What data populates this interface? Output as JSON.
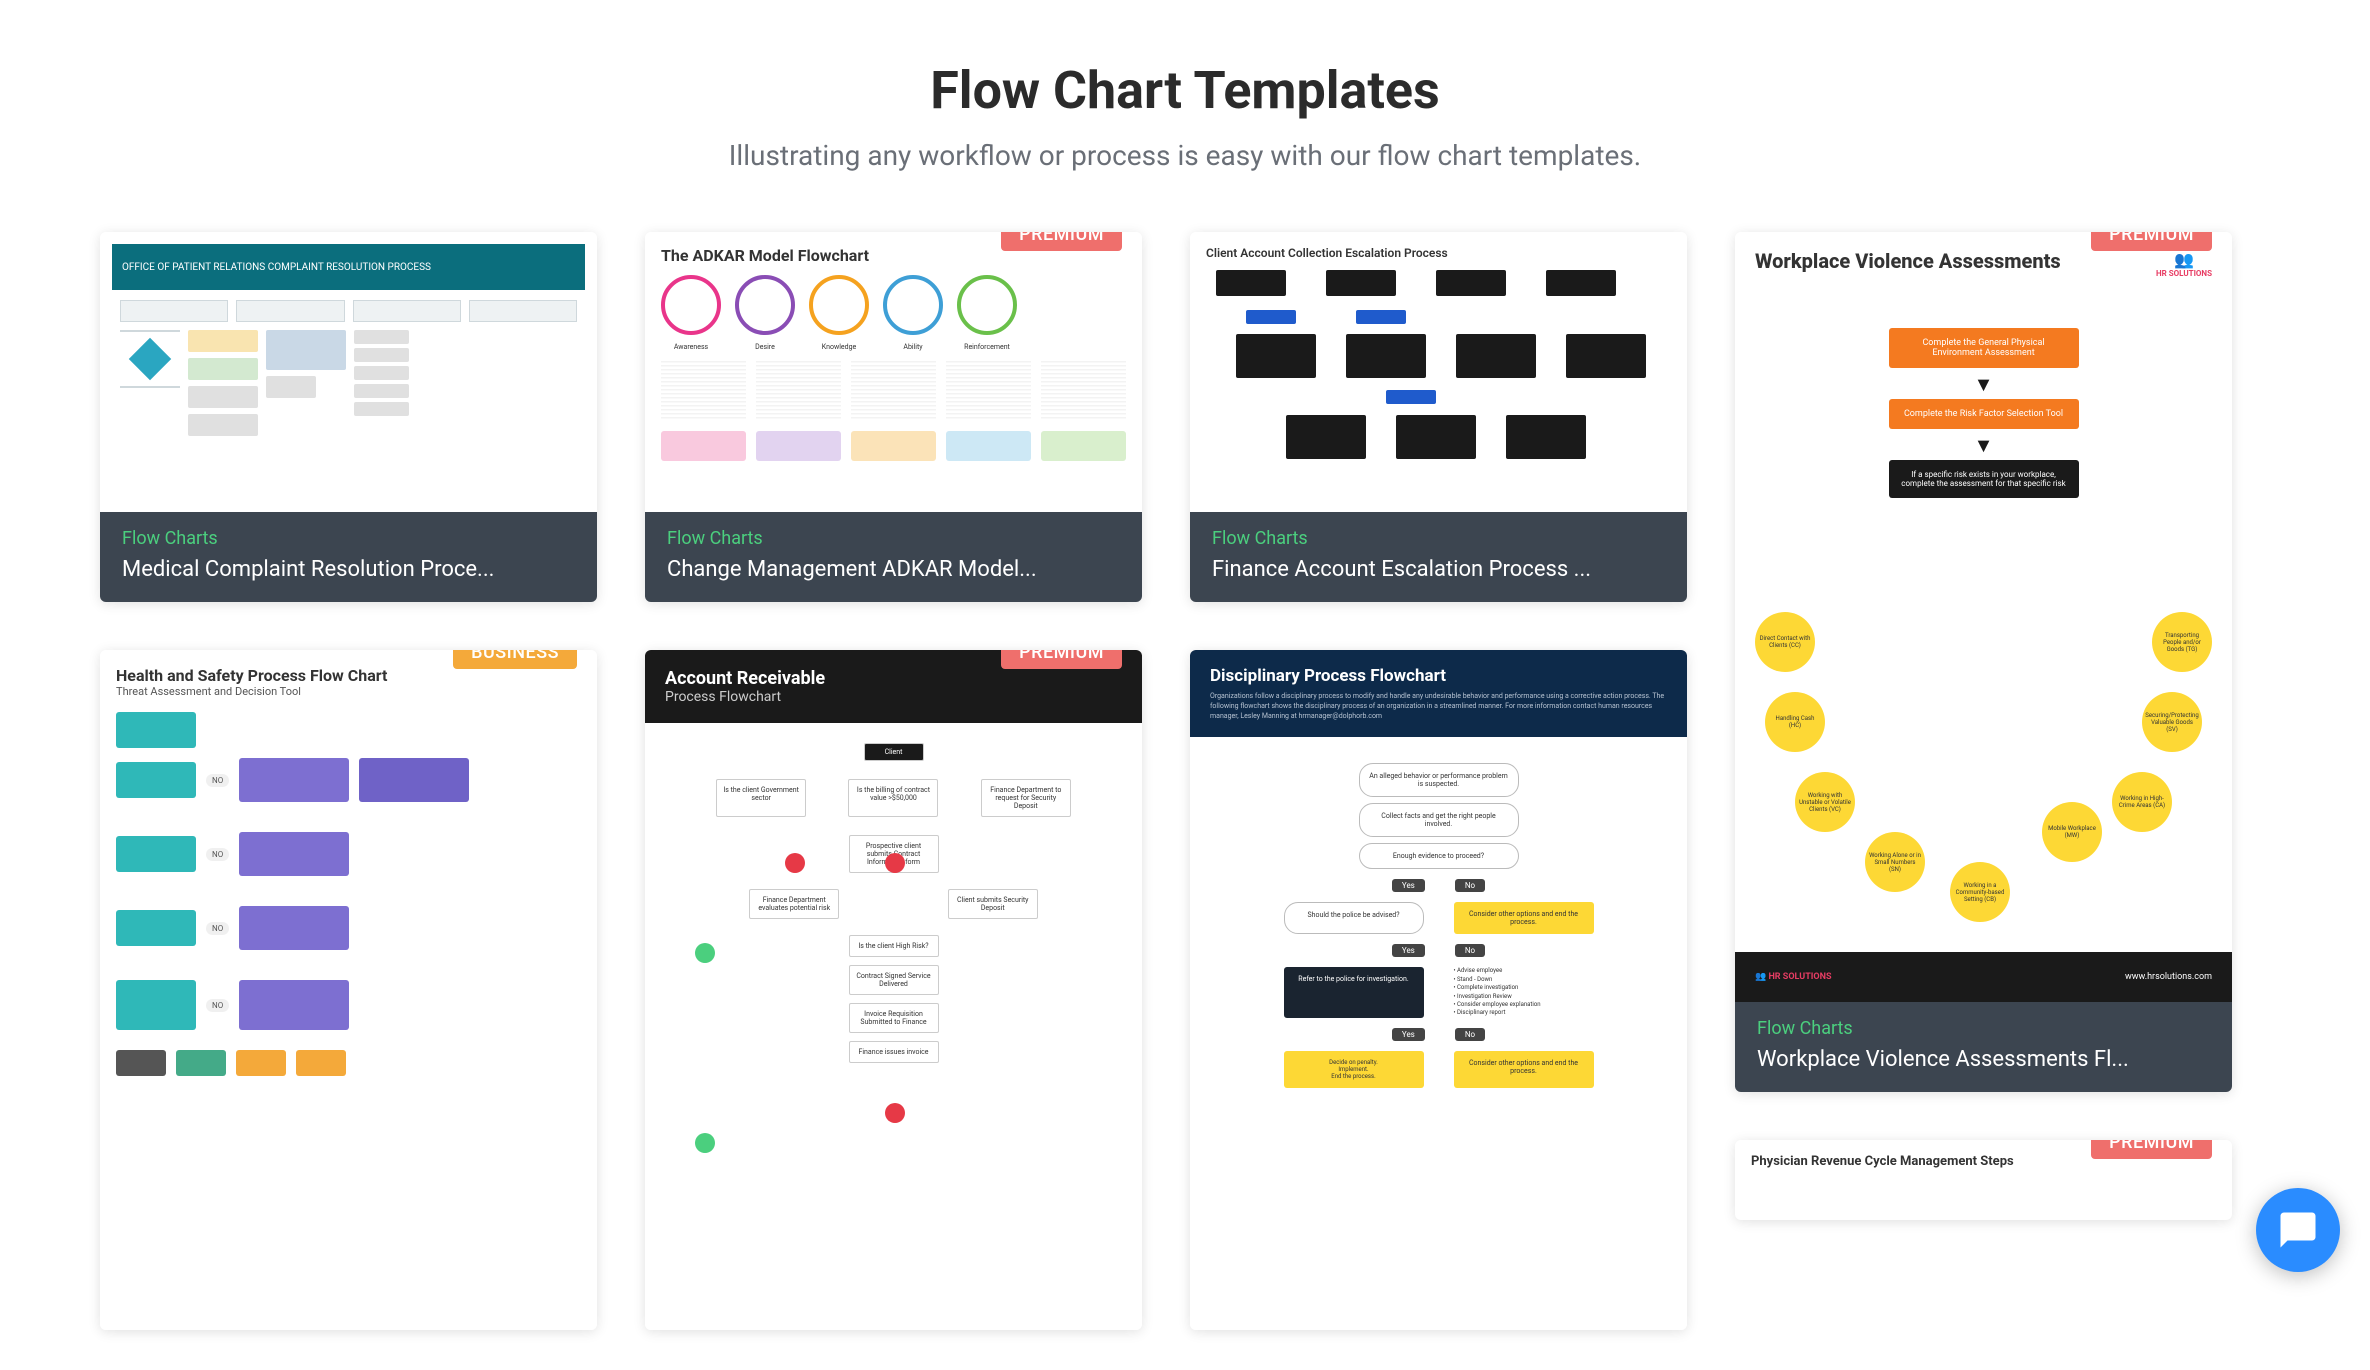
{
  "header": {
    "title": "Flow Chart Templates",
    "subtitle": "Illustrating any workflow or process is easy with our flow chart templates."
  },
  "badges": {
    "premium": "PREMIUM",
    "business": "BUSINESS"
  },
  "category": "Flow Charts",
  "cards": {
    "medical": {
      "title": "Medical Complaint Resolution Proce...",
      "thumb_header": "OFFICE OF PATIENT RELATIONS COMPLAINT RESOLUTION PROCESS"
    },
    "adkar": {
      "title": "Change Management ADKAR Model...",
      "thumb_title": "The ADKAR Model Flowchart",
      "labels": [
        "Awareness",
        "Desire",
        "Knowledge",
        "Ability",
        "Reinforcement"
      ]
    },
    "finance": {
      "title": "Finance Account Escalation Process ...",
      "thumb_title": "Client Account Collection Escalation Process"
    },
    "violence": {
      "title": "Workplace Violence Assessments Fl...",
      "thumb_title": "Workplace Violence Assessments",
      "brand": "HR SOLUTIONS",
      "url": "www.hrsolutions.com",
      "box1": "Complete the General Physical Environment Assessment",
      "box2": "Complete the Risk Factor Selection Tool",
      "box3": "If a specific risk exists in your workplace, complete the assessment for that specific risk",
      "y1": "Direct Contact with Clients (CC)",
      "y2": "Handling Cash (HC)",
      "y3": "Working with Unstable or Volatile Clients (VC)",
      "y4": "Working Alone or in Small Numbers (SN)",
      "y5": "Transporting People and/or Goods (TG)",
      "y6": "Securing/Protecting Valuable Goods (SV)",
      "y7": "Working in High-Crime Areas (CA)",
      "y8": "Mobile Workplace (MW)",
      "y9": "Working in a Community-based Setting (CB)"
    },
    "health": {
      "title_line1": "Health and Safety Process Flow Chart",
      "title_line2": "Threat Assessment and Decision Tool"
    },
    "ar": {
      "title_a": "Account Receivable",
      "title_b": "Process Flowchart",
      "client": "Client"
    },
    "disc": {
      "title": "Disciplinary Process Flowchart",
      "sub": "Organizations follow a disciplinary process to modify and handle any undesirable behavior and performance using a corrective action process. The following flowchart shows the disciplinary process of an organization in a streamlined manner. For more information contact human resources manager, Lesley Manning at hrmanager@dolphorb.com",
      "w1": "An alleged behavior or performance problem is suspected.",
      "w2": "Collect facts and get the right people involved.",
      "w3": "Enough evidence to proceed?",
      "yes": "Yes",
      "no": "No",
      "police": "Should the police be advised?",
      "dark": "Refer to the police for investigation.",
      "y1": "Consider other options and end the process.",
      "y2": "Consider other options and end the process."
    },
    "phys": {
      "thumb_title": "Physician Revenue Cycle Management Steps"
    }
  }
}
